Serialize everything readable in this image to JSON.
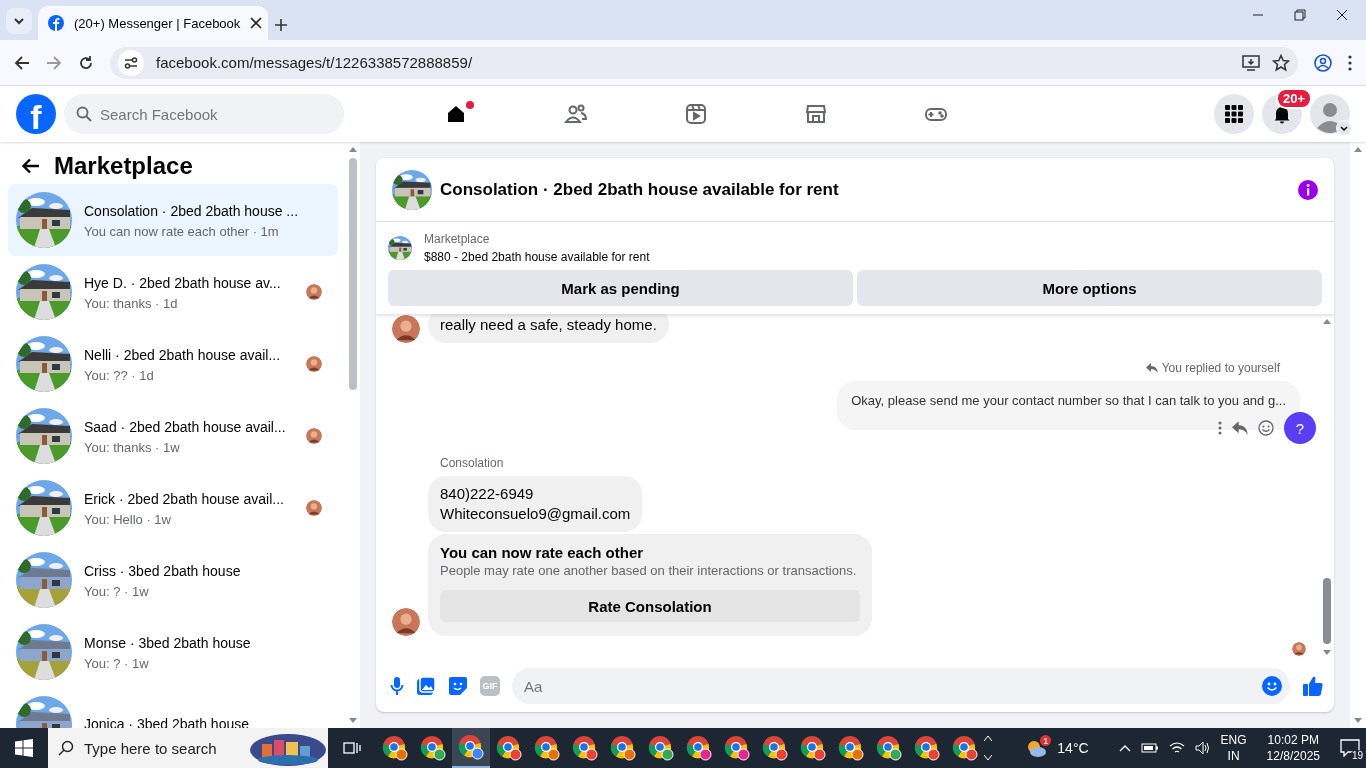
{
  "browser": {
    "tab_title": "(20+) Messenger | Facebook",
    "url": "facebook.com/messages/t/1226338572888859/"
  },
  "header": {
    "logo": "f",
    "search_placeholder": "Search Facebook",
    "nav": [
      {
        "kind": "home",
        "dot": true
      },
      {
        "kind": "friends",
        "dot": false
      },
      {
        "kind": "video",
        "dot": false
      },
      {
        "kind": "marketplace",
        "dot": false
      },
      {
        "kind": "gaming",
        "dot": false
      }
    ],
    "notifications_badge": "20+"
  },
  "sidebar": {
    "title": "Marketplace",
    "conversations": [
      {
        "name": "Consolation · 2bed 2bath house ...",
        "preview": "You can now rate each other · 1m",
        "selected": true,
        "seen": false
      },
      {
        "name": "Hye D. · 2bed 2bath house av...",
        "preview": "You: thanks · 1d",
        "selected": false,
        "seen": true
      },
      {
        "name": "Nelli · 2bed 2bath house avail...",
        "preview": "You: ?? · 1d",
        "selected": false,
        "seen": true
      },
      {
        "name": "Saad · 2bed 2bath house avail...",
        "preview": "You: thanks · 1w",
        "selected": false,
        "seen": true
      },
      {
        "name": "Erick · 2bed 2bath house avail...",
        "preview": "You: Hello · 1w",
        "selected": false,
        "seen": true
      },
      {
        "name": "Criss · 3bed 2bath house",
        "preview": "You: ? · 1w",
        "selected": false,
        "seen": false
      },
      {
        "name": "Monse · 3bed 2bath house",
        "preview": "You: ? · 1w",
        "selected": false,
        "seen": false
      },
      {
        "name": "Jonica · 3bed 2bath house",
        "selected": false,
        "seen": false
      }
    ]
  },
  "chat": {
    "title": "Consolation · 2bed 2bath house available for rent",
    "listing": {
      "label": "Marketplace",
      "title": "$880 - 2bed 2bath house available for rent"
    },
    "actions": [
      "Mark as pending",
      "More options"
    ],
    "messages": [
      {
        "kind": "incoming",
        "lines": [
          "really need a safe, steady home."
        ],
        "avatar": true
      },
      {
        "kind": "outgoing",
        "note": "You replied to yourself",
        "text": "Okay, please send me your contact number so that I can talk to you and g...",
        "help": "?"
      },
      {
        "kind": "incoming",
        "sender": "Consolation",
        "lines": [
          "840)222-6949",
          "Whiteconsuelo9@gmail.com"
        ],
        "avatar": false
      },
      {
        "kind": "rating",
        "title": "You can now rate each other",
        "subtitle": "People may rate one another based on their interactions or transactions.",
        "button": "Rate Consolation",
        "avatar": true
      }
    ],
    "composer": {
      "placeholder": "Aa",
      "gif": "GIF"
    }
  },
  "taskbar": {
    "search_placeholder": "Type here to search",
    "apps": [
      {
        "selected": false,
        "color": "#e8710a"
      },
      {
        "selected": false,
        "color": "#34a853"
      },
      {
        "selected": true,
        "color": "#4285f4"
      },
      {
        "selected": false,
        "color": "#ea4335"
      },
      {
        "selected": false,
        "color": "#e8710a"
      },
      {
        "selected": false,
        "color": "#ea4335"
      },
      {
        "selected": false,
        "color": "#e8710a"
      },
      {
        "selected": false,
        "color": "#34a853"
      },
      {
        "selected": false,
        "color": "#e52592"
      },
      {
        "selected": false,
        "color": "#e52592"
      },
      {
        "selected": false,
        "color": "#ea4335"
      },
      {
        "selected": false,
        "color": "#ea4335"
      },
      {
        "selected": false,
        "color": "#e8710a"
      },
      {
        "selected": false,
        "color": "#34a853"
      },
      {
        "selected": false,
        "color": "#ea4335"
      },
      {
        "selected": false,
        "color": "#ea4335"
      }
    ],
    "weather": "14°C",
    "weather_badge": "1",
    "lang": "ENG",
    "region": "IN",
    "time": "10:02 PM",
    "date": "12/8/2025",
    "notifications": "19"
  }
}
